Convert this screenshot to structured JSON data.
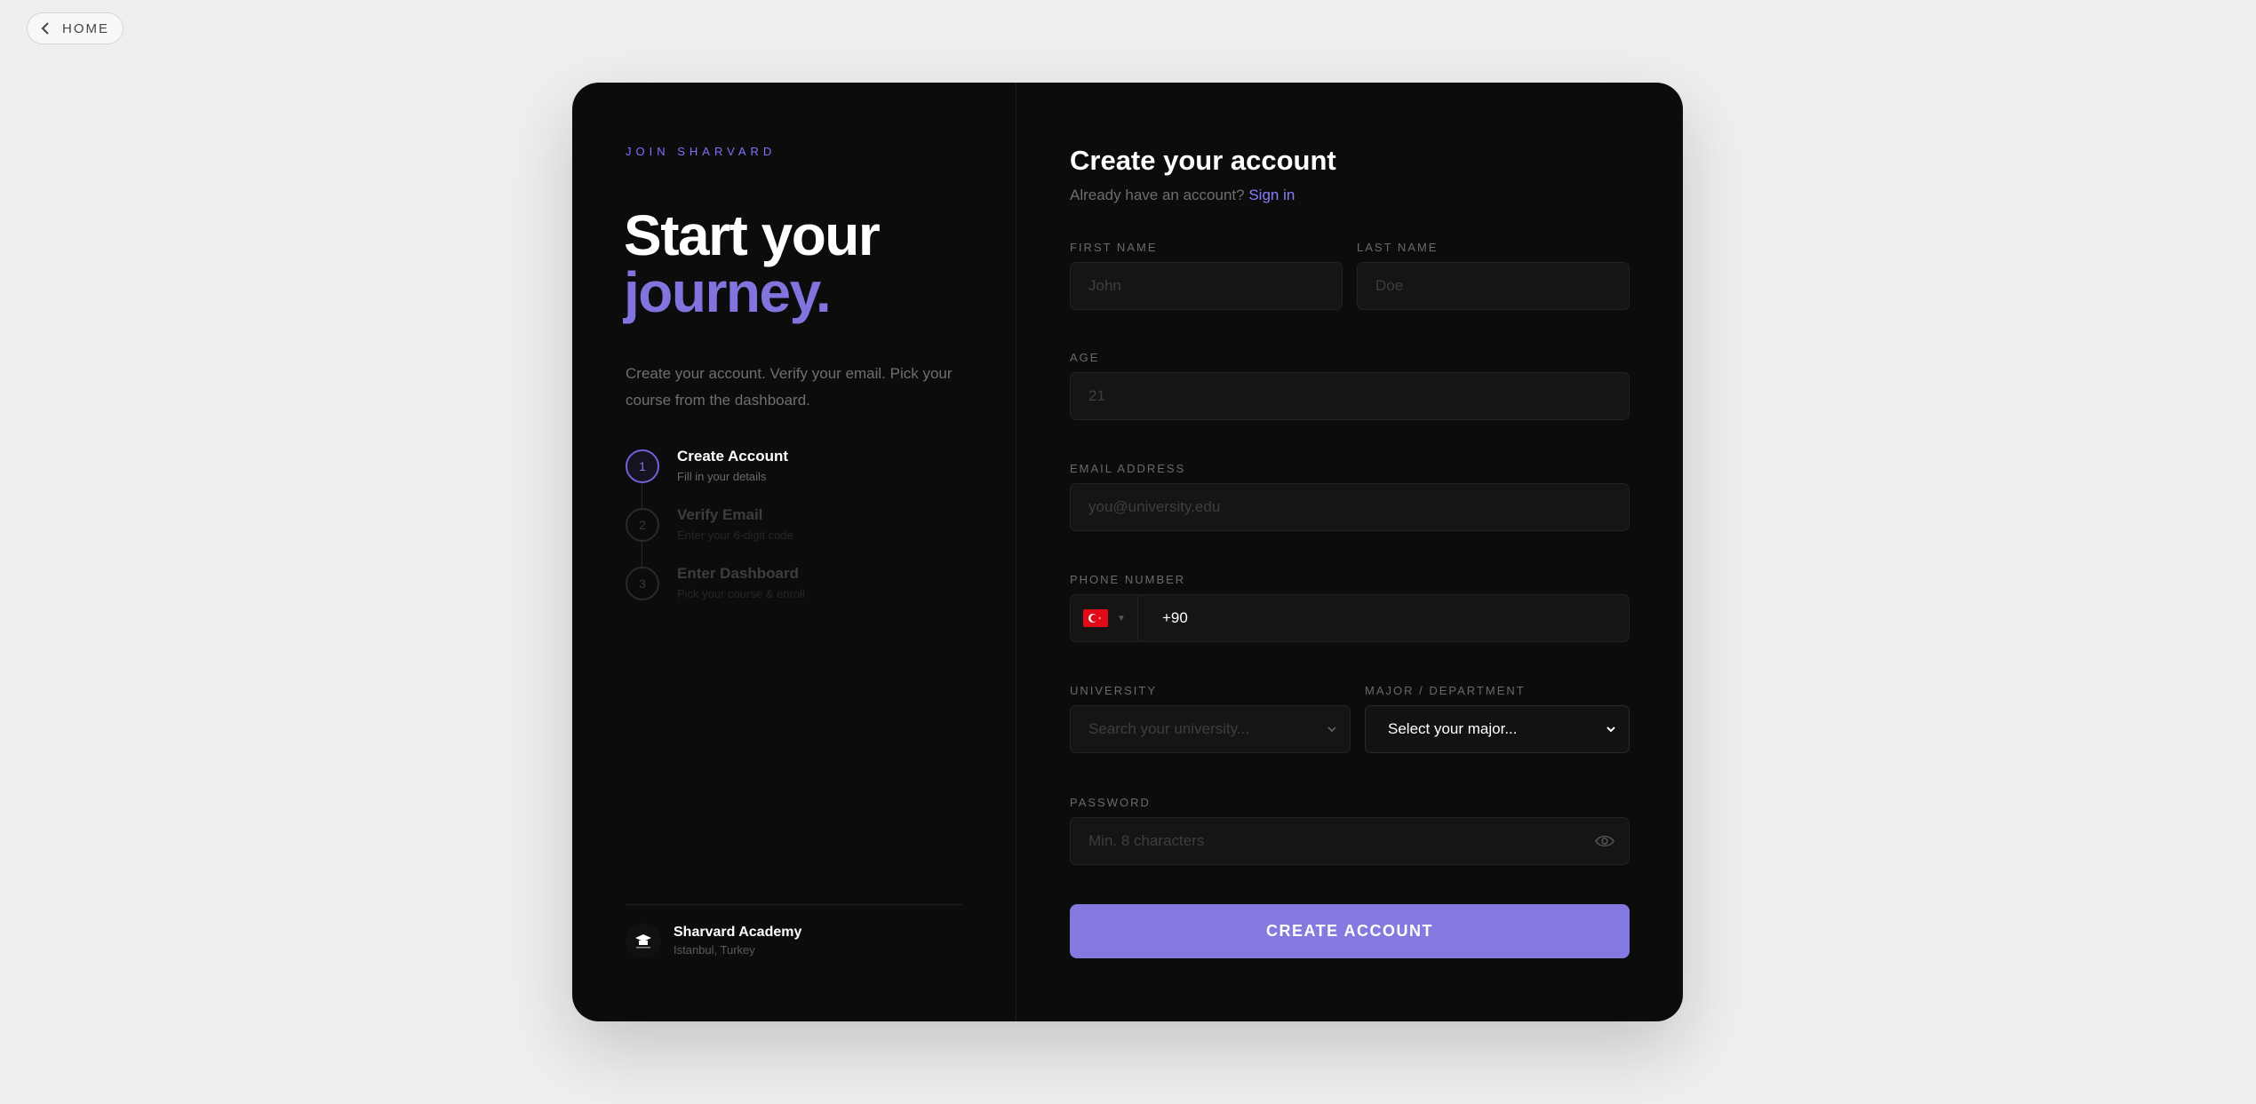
{
  "nav": {
    "home_label": "HOME"
  },
  "left": {
    "eyebrow": "JOIN SHARVARD",
    "hero_line1": "Start your",
    "hero_line2": "journey.",
    "intro": "Create your account. Verify your email. Pick your course from the dashboard.",
    "steps": [
      {
        "num": "1",
        "title": "Create Account",
        "subtitle": "Fill in your details"
      },
      {
        "num": "2",
        "title": "Verify Email",
        "subtitle": "Enter your 6-digit code"
      },
      {
        "num": "3",
        "title": "Enter Dashboard",
        "subtitle": "Pick your course & enroll"
      }
    ],
    "footer": {
      "name": "Sharvard Academy",
      "location": "Istanbul, Turkey"
    }
  },
  "form": {
    "title": "Create your account",
    "signin_prompt": "Already have an account?",
    "signin_link": "Sign in",
    "first_name": {
      "label": "FIRST NAME",
      "placeholder": "John"
    },
    "last_name": {
      "label": "LAST NAME",
      "placeholder": "Doe"
    },
    "age": {
      "label": "AGE",
      "placeholder": "21"
    },
    "email": {
      "label": "EMAIL ADDRESS",
      "placeholder": "you@university.edu"
    },
    "phone": {
      "label": "PHONE NUMBER",
      "value": "+90"
    },
    "university": {
      "label": "UNIVERSITY",
      "placeholder": "Search your university..."
    },
    "major": {
      "label": "MAJOR / DEPARTMENT",
      "value": "Select your major..."
    },
    "password": {
      "label": "PASSWORD",
      "placeholder": "Min. 8 characters"
    },
    "submit_label": "CREATE ACCOUNT"
  },
  "colors": {
    "accent": "#8479df",
    "card": "#0c0c0c",
    "background": "#efefef"
  }
}
